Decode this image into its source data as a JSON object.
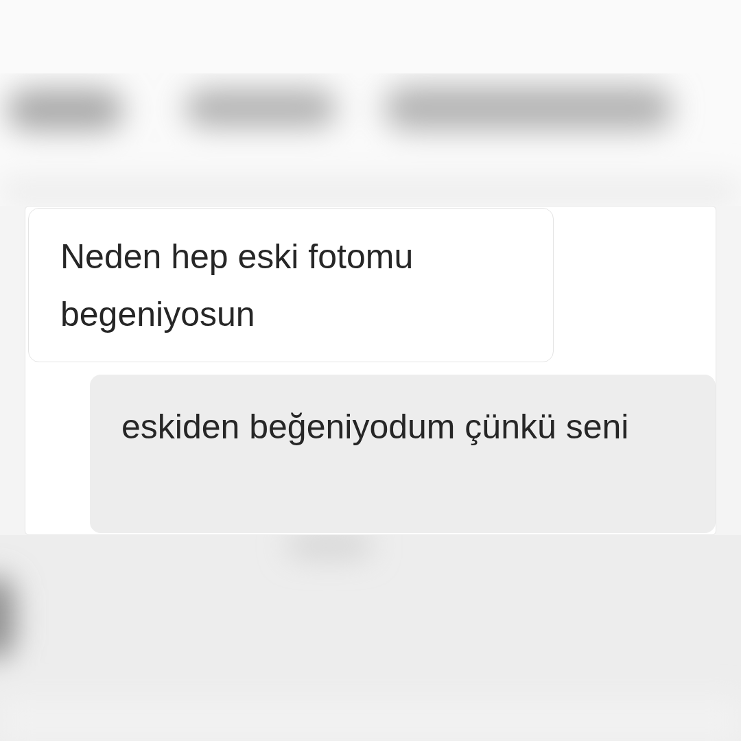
{
  "messages": [
    {
      "text": "Neden hep eski fotomu begeniyosun",
      "kind": "received"
    },
    {
      "text": "eskiden beğeniyodum çünkü seni",
      "kind": "sent"
    }
  ]
}
